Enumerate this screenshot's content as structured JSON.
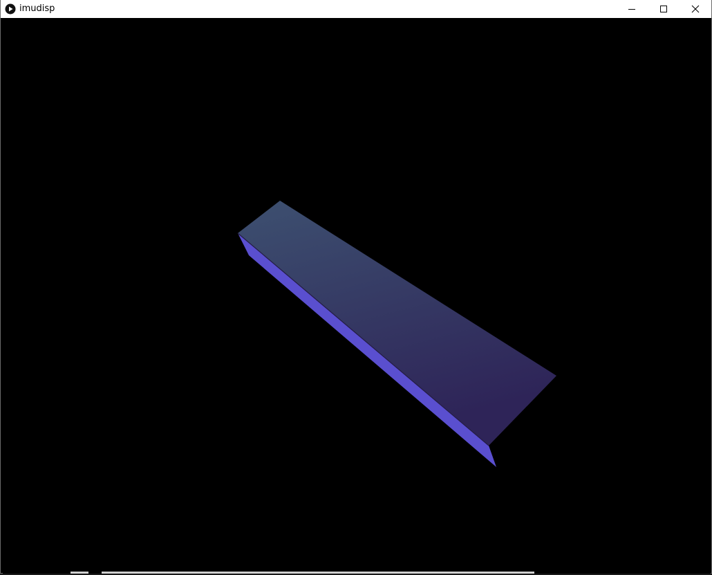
{
  "window": {
    "title": "imudisp"
  },
  "icons": {
    "app": "play-circle-icon",
    "minimize": "minimize-icon",
    "maximize": "maximize-icon",
    "close": "close-icon"
  },
  "scene": {
    "background": "#000000",
    "top_face_light": "#3d5070",
    "top_face_dark": "#2e2458",
    "side_face": "#5a4fcf",
    "edge_color": "#241c44"
  }
}
